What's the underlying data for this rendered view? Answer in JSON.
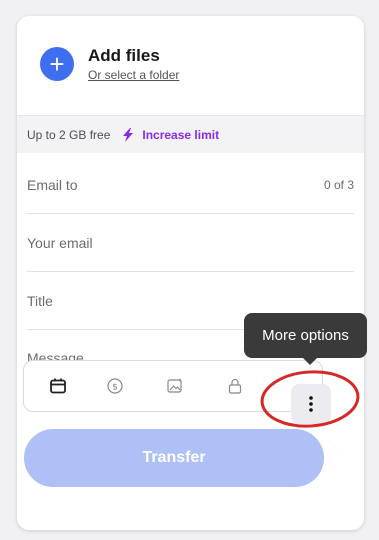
{
  "upload": {
    "title": "Add files",
    "subtitle": "Or select a folder",
    "plus": "+"
  },
  "limit": {
    "text": "Up to 2 GB free",
    "link": "Increase limit"
  },
  "fields": {
    "email_to": {
      "placeholder": "Email to",
      "count": "0 of 3"
    },
    "your_email": {
      "placeholder": "Your email"
    },
    "title": {
      "placeholder": "Title"
    },
    "message": {
      "placeholder": "Message"
    }
  },
  "toolbar": {
    "icons": [
      "calendar-icon",
      "dollar-icon",
      "image-icon",
      "lock-icon",
      "more-options-icon"
    ]
  },
  "tooltip": {
    "text": "More options"
  },
  "transfer": {
    "label": "Transfer"
  },
  "colors": {
    "accent": "#3f6ff0",
    "link_purple": "#8a2be2",
    "transfer_disabled": "#aec0f5",
    "annotation_red": "#d62828"
  }
}
